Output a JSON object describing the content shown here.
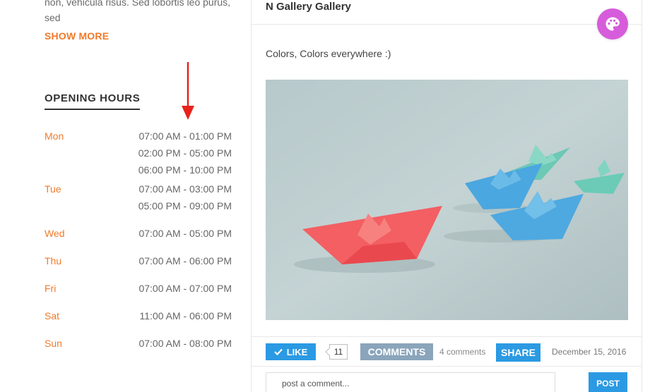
{
  "about": {
    "text": "non, vehicula risus. Sed lobortis leo purus, sed",
    "show_more": "SHOW MORE"
  },
  "opening_hours": {
    "title": "OPENING HOURS",
    "days": [
      {
        "day": "Mon",
        "times": [
          "07:00 AM - 01:00 PM",
          "02:00 PM - 05:00 PM",
          "06:00 PM - 10:00 PM"
        ]
      },
      {
        "day": "Tue",
        "times": [
          "07:00 AM - 03:00 PM",
          "05:00 PM - 09:00 PM"
        ]
      },
      {
        "day": "Wed",
        "times": [
          "07:00 AM - 05:00 PM"
        ]
      },
      {
        "day": "Thu",
        "times": [
          "07:00 AM - 06:00 PM"
        ]
      },
      {
        "day": "Fri",
        "times": [
          "07:00 AM - 07:00 PM"
        ]
      },
      {
        "day": "Sat",
        "times": [
          "11:00 AM - 06:00 PM"
        ]
      },
      {
        "day": "Sun",
        "times": [
          "07:00 AM - 08:00 PM"
        ]
      }
    ]
  },
  "post": {
    "title": "N Gallery Gallery",
    "text": "Colors, Colors everywhere :)",
    "like_label": "LIKE",
    "like_count": "11",
    "comments_label": "COMMENTS",
    "comments_count": "4 comments",
    "share_label": "SHARE",
    "date": "December 15, 2016",
    "comment_placeholder": "post a comment...",
    "post_label": "POST"
  },
  "icons": {
    "palette": "palette-icon",
    "like": "check-icon"
  },
  "colors": {
    "accent_orange": "#f07a2a",
    "primary_blue": "#2b9ae3",
    "comments_gray": "#8aa5bb",
    "palette_purple": "#d65cdb"
  }
}
